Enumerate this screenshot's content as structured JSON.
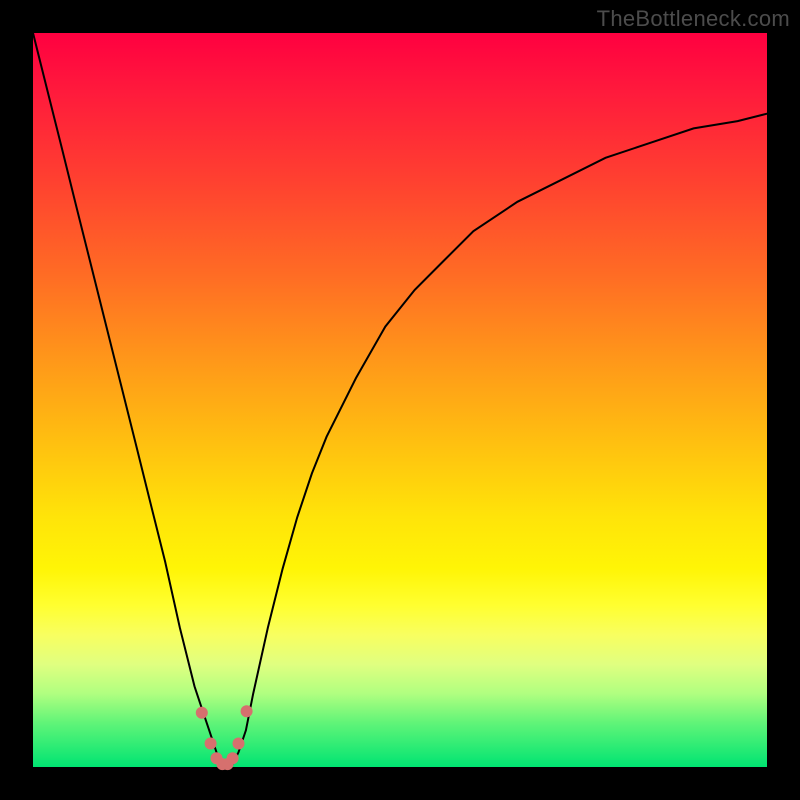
{
  "watermark": "TheBottleneck.com",
  "colors": {
    "frame": "#000000",
    "curve": "#000000",
    "dots": "#d6706e",
    "gradient_top": "#ff0040",
    "gradient_bottom": "#00e472"
  },
  "chart_data": {
    "type": "line",
    "title": "",
    "xlabel": "",
    "ylabel": "",
    "xlim": [
      0,
      100
    ],
    "ylim": [
      0,
      100
    ],
    "x": [
      0,
      2,
      4,
      6,
      8,
      10,
      12,
      14,
      16,
      18,
      20,
      22,
      23,
      24,
      25,
      26,
      27,
      28,
      29,
      30,
      32,
      34,
      36,
      38,
      40,
      44,
      48,
      52,
      56,
      60,
      66,
      72,
      78,
      84,
      90,
      96,
      100
    ],
    "y": [
      100,
      92,
      84,
      76,
      68,
      60,
      52,
      44,
      36,
      28,
      19,
      11,
      8,
      5,
      2,
      0,
      0,
      2,
      5,
      10,
      19,
      27,
      34,
      40,
      45,
      53,
      60,
      65,
      69,
      73,
      77,
      80,
      83,
      85,
      87,
      88,
      89
    ],
    "highlight_points": {
      "x": [
        23.0,
        24.2,
        25.0,
        25.8,
        26.5,
        27.2,
        28.0,
        29.1
      ],
      "y": [
        7.4,
        3.2,
        1.2,
        0.4,
        0.4,
        1.2,
        3.2,
        7.6
      ]
    }
  }
}
